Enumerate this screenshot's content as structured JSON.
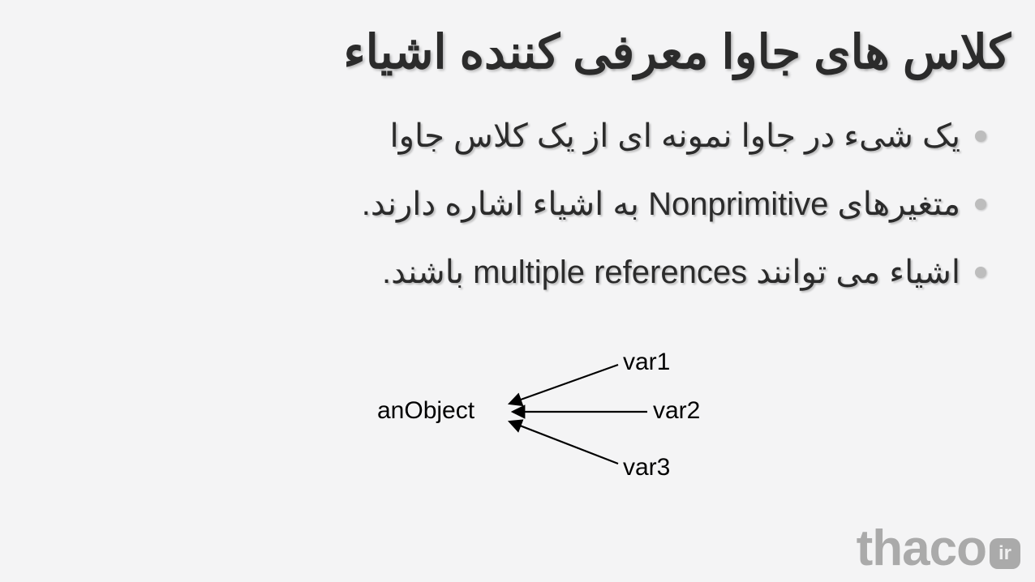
{
  "title": "کلاس های جاوا معرفی کننده اشیاء",
  "bullets": [
    "یک شیء در جاوا نمونه ای از یک کلاس جاوا",
    "متغیرهای Nonprimitive به اشیاء اشاره دارند.",
    "اشیاء می توانند multiple references باشند."
  ],
  "diagram": {
    "object_label": "anObject",
    "var_labels": [
      "var1",
      "var2",
      "var3"
    ]
  },
  "watermark": {
    "main": "thaco",
    "suffix": "ir"
  }
}
